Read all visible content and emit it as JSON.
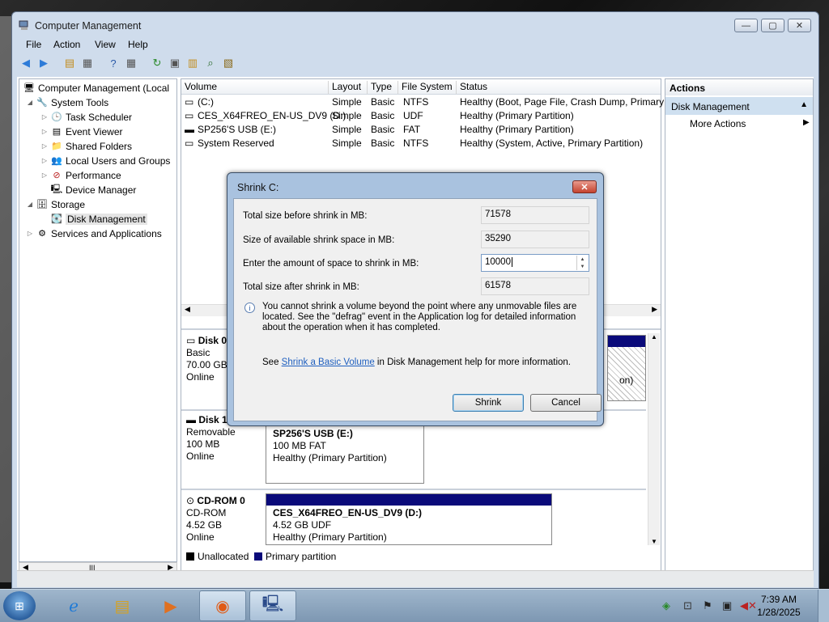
{
  "window": {
    "title": "Computer Management",
    "controls": {
      "minimize": "—",
      "maximize": "▢",
      "close": "✕"
    }
  },
  "menu": {
    "file": "File",
    "action": "Action",
    "view": "View",
    "help": "Help"
  },
  "tree": {
    "root": "Computer Management (Local",
    "system_tools": "System Tools",
    "task_scheduler": "Task Scheduler",
    "event_viewer": "Event Viewer",
    "shared_folders": "Shared Folders",
    "local_users": "Local Users and Groups",
    "performance": "Performance",
    "device_manager": "Device Manager",
    "storage": "Storage",
    "disk_management": "Disk Management",
    "services": "Services and Applications",
    "scroll_grip": "III"
  },
  "volumes": {
    "headers": {
      "volume": "Volume",
      "layout": "Layout",
      "type": "Type",
      "fs": "File System",
      "status": "Status"
    },
    "rows": [
      {
        "volume": "(C:)",
        "layout": "Simple",
        "type": "Basic",
        "fs": "NTFS",
        "status": "Healthy (Boot, Page File, Crash Dump, Primary"
      },
      {
        "volume": "CES_X64FREO_EN-US_DV9 (D:)",
        "layout": "Simple",
        "type": "Basic",
        "fs": "UDF",
        "status": "Healthy (Primary Partition)"
      },
      {
        "volume": "SP256'S USB (E:)",
        "layout": "Simple",
        "type": "Basic",
        "fs": "FAT",
        "status": "Healthy (Primary Partition)"
      },
      {
        "volume": "System Reserved",
        "layout": "Simple",
        "type": "Basic",
        "fs": "NTFS",
        "status": "Healthy (System, Active, Primary Partition)"
      }
    ]
  },
  "disks": {
    "disk0": {
      "name": "Disk 0",
      "kind": "Basic",
      "size": "70.00 GB",
      "state": "Online",
      "partial": "on)"
    },
    "disk1": {
      "name": "Disk 1",
      "kind": "Removable",
      "size": "100 MB",
      "state": "Online"
    },
    "disk1_part": {
      "name": "SP256'S USB  (E:)",
      "size": "100 MB FAT",
      "status": "Healthy (Primary Partition)"
    },
    "cdrom0": {
      "name": "CD-ROM 0",
      "kind": "CD-ROM",
      "size": "4.52 GB",
      "state": "Online"
    },
    "cdrom0_part": {
      "name": "CES_X64FREO_EN-US_DV9  (D:)",
      "size": "4.52 GB UDF",
      "status": "Healthy (Primary Partition)"
    }
  },
  "legend": {
    "unallocated": "Unallocated",
    "primary": "Primary partition",
    "unallocated_color": "#000000",
    "primary_color": "#0a0a7a"
  },
  "actions": {
    "header": "Actions",
    "section": "Disk Management",
    "more": "More Actions"
  },
  "dialog": {
    "title": "Shrink C:",
    "close": "✕",
    "total_before_label": "Total size before shrink in MB:",
    "total_before_value": "71578",
    "available_label": "Size of available shrink space in MB:",
    "available_value": "35290",
    "amount_label": "Enter the amount of space to shrink in MB:",
    "amount_value": "10000",
    "total_after_label": "Total size after shrink in MB:",
    "total_after_value": "61578",
    "note": "You cannot shrink a volume beyond the point where any unmovable files are located. See the \"defrag\" event in the Application log for detailed information about the operation when it has completed.",
    "help_prefix": "See ",
    "help_link": "Shrink a Basic Volume",
    "help_suffix": " in Disk Management help for more information.",
    "shrink_button": "Shrink",
    "cancel_button": "Cancel"
  },
  "taskbar": {
    "time": "7:39 AM",
    "date": "1/28/2025"
  }
}
